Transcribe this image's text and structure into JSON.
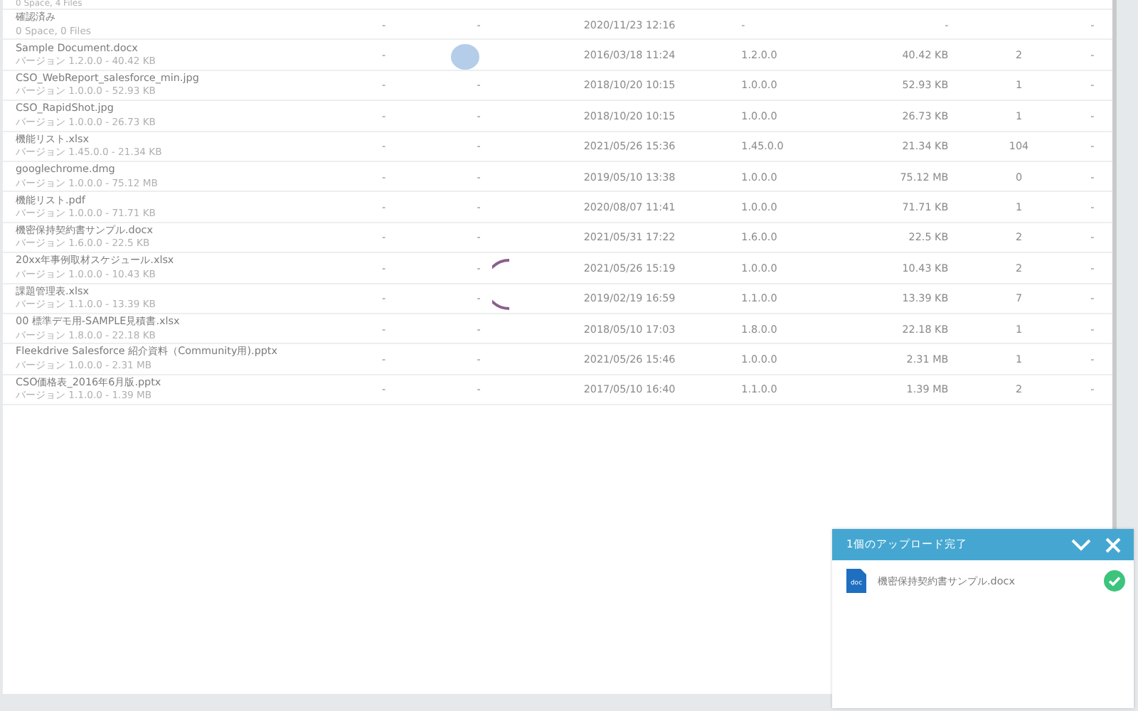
{
  "folder_summary": "0 Space, 4 Files",
  "rows": [
    {
      "name": "確認済み",
      "detail": "0 Space, 0 Files",
      "column_2": "-",
      "column_3": "-",
      "date": "2020/11/23 12:16",
      "version": "-",
      "size": "-",
      "count": "",
      "column_8": "-"
    },
    {
      "name": "Sample Document.docx",
      "detail": "バージョン 1.2.0.0 - 40.42 KB",
      "column_2": "-",
      "column_3": "",
      "date": "2016/03/18 11:24",
      "version": "1.2.0.0",
      "size": "40.42 KB",
      "count": "2",
      "column_8": "-"
    },
    {
      "name": "CSO_WebReport_salesforce_min.jpg",
      "detail": "バージョン 1.0.0.0 - 52.93 KB",
      "column_2": "-",
      "column_3": "-",
      "date": "2018/10/20 10:15",
      "version": "1.0.0.0",
      "size": "52.93 KB",
      "count": "1",
      "column_8": "-"
    },
    {
      "name": "CSO_RapidShot.jpg",
      "detail": "バージョン 1.0.0.0 - 26.73 KB",
      "column_2": "-",
      "column_3": "-",
      "date": "2018/10/20 10:15",
      "version": "1.0.0.0",
      "size": "26.73 KB",
      "count": "1",
      "column_8": "-"
    },
    {
      "name": "機能リスト.xlsx",
      "detail": "バージョン 1.45.0.0 - 21.34 KB",
      "column_2": "-",
      "column_3": "-",
      "date": "2021/05/26 15:36",
      "version": "1.45.0.0",
      "size": "21.34 KB",
      "count": "104",
      "column_8": "-"
    },
    {
      "name": "googlechrome.dmg",
      "detail": "バージョン 1.0.0.0 - 75.12 MB",
      "column_2": "-",
      "column_3": "-",
      "date": "2019/05/10 13:38",
      "version": "1.0.0.0",
      "size": "75.12 MB",
      "count": "0",
      "column_8": "-"
    },
    {
      "name": "機能リスト.pdf",
      "detail": "バージョン 1.0.0.0 - 71.71 KB",
      "column_2": "-",
      "column_3": "-",
      "date": "2020/08/07 11:41",
      "version": "1.0.0.0",
      "size": "71.71 KB",
      "count": "1",
      "column_8": "-"
    },
    {
      "name": "機密保持契約書サンプル.docx",
      "detail": "バージョン 1.6.0.0 - 22.5 KB",
      "column_2": "-",
      "column_3": "-",
      "date": "2021/05/31 17:22",
      "version": "1.6.0.0",
      "size": "22.5 KB",
      "count": "2",
      "column_8": "-"
    },
    {
      "name": "20xx年事例取材スケジュール.xlsx",
      "detail": "バージョン 1.0.0.0 - 10.43 KB",
      "column_2": "-",
      "column_3": "-",
      "date": "2021/05/26 15:19",
      "version": "1.0.0.0",
      "size": "10.43 KB",
      "count": "2",
      "column_8": "-"
    },
    {
      "name": "課題管理表.xlsx",
      "detail": "バージョン 1.1.0.0 - 13.39 KB",
      "column_2": "-",
      "column_3": "-",
      "date": "2019/02/19 16:59",
      "version": "1.1.0.0",
      "size": "13.39 KB",
      "count": "7",
      "column_8": "-"
    },
    {
      "name": "00 標準デモ用-SAMPLE見積書.xlsx",
      "detail": "バージョン 1.8.0.0 - 22.18 KB",
      "column_2": "-",
      "column_3": "-",
      "date": "2018/05/10 17:03",
      "version": "1.8.0.0",
      "size": "22.18 KB",
      "count": "1",
      "column_8": "-"
    },
    {
      "name": "Fleekdrive Salesforce 紹介資料（Community用).pptx",
      "detail": "バージョン 1.0.0.0 - 2.31 MB",
      "column_2": "-",
      "column_3": "-",
      "date": "2021/05/26 15:46",
      "version": "1.0.0.0",
      "size": "2.31 MB",
      "count": "1",
      "column_8": "-"
    },
    {
      "name": "CSO価格表_2016年6月版.pptx",
      "detail": "バージョン 1.1.0.0 - 1.39 MB",
      "column_2": "-",
      "column_3": "-",
      "date": "2017/05/10 16:40",
      "version": "1.1.0.0",
      "size": "1.39 MB",
      "count": "2",
      "column_8": "-"
    }
  ],
  "upload_panel": {
    "title": "1個のアップロード完了",
    "files": [
      {
        "name": "機密保持契約書サンプル.docx",
        "type_label": "doc",
        "done": true
      }
    ]
  }
}
